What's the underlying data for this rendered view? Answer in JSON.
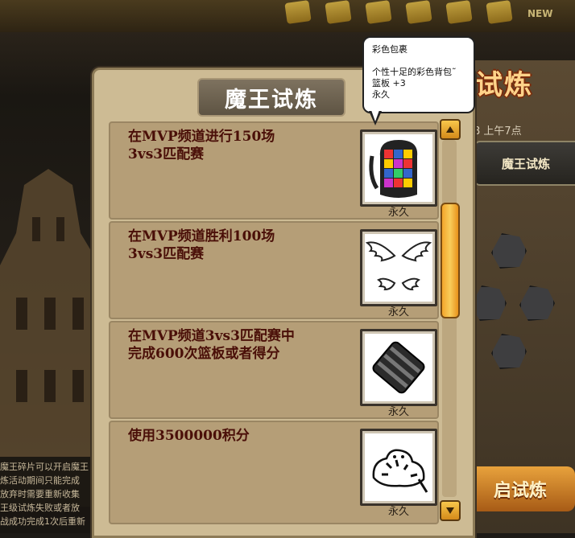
{
  "panel": {
    "title": "魔王试炼"
  },
  "tasks": [
    {
      "text_line1": "在MVP频道进行150场",
      "text_line2": "3vs3匹配赛",
      "item_icon": "colorful-backpack-icon",
      "duration": "永久"
    },
    {
      "text_line1": "在MVP频道胜利100场",
      "text_line2": "3vs3匹配赛",
      "item_icon": "white-wings-icon",
      "duration": "永久"
    },
    {
      "text_line1": "在MVP频道3vs3匹配赛中",
      "text_line2": "完成600次篮板或者得分",
      "item_icon": "armband-icon",
      "duration": "永久"
    },
    {
      "text_line1": "使用3500000积分",
      "text_line2": "",
      "item_icon": "white-tiger-icon",
      "duration": "永久"
    }
  ],
  "tooltip": {
    "name": "彩色包裹",
    "description": "个性十足的彩色背包˜",
    "stat": "篮板 +3",
    "duration": "永久"
  },
  "background": {
    "news_label": "NEW",
    "right_title": "试炼",
    "right_time": "8 上午7点",
    "right_tab": "魔王试炼",
    "right_button": "启试炼",
    "left_info_lines": [
      "魔王碎片可以开启魔王",
      "炼活动期间只能完成",
      "放弃时需要重新收集",
      "王级试炼失败或者放",
      "战成功完成1次后重新"
    ]
  },
  "colors": {
    "panel_bg": "#cdbb94",
    "task_bg": "#b59e77",
    "task_text": "#4a0f08",
    "scroll_accent": "#f9cd5a"
  }
}
